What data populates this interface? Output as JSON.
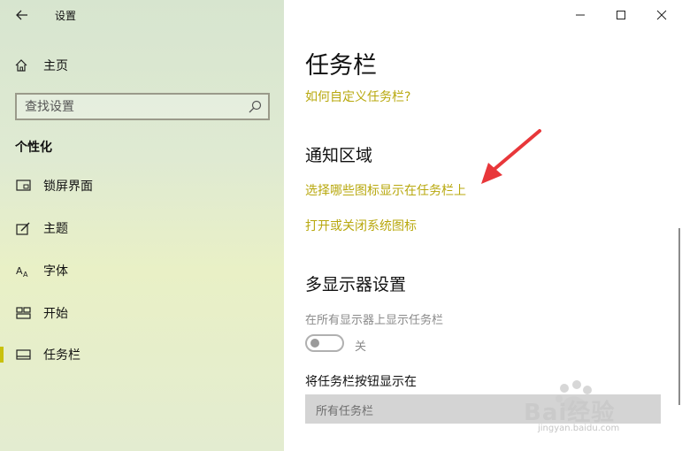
{
  "window": {
    "title": "设置"
  },
  "sidebar": {
    "home_label": "主页",
    "search_placeholder": "查找设置",
    "section_title": "个性化",
    "items": [
      {
        "label": "锁屏界面",
        "icon": "lock-screen-icon"
      },
      {
        "label": "主题",
        "icon": "theme-icon"
      },
      {
        "label": "字体",
        "icon": "font-icon"
      },
      {
        "label": "开始",
        "icon": "start-icon"
      },
      {
        "label": "任务栏",
        "icon": "taskbar-icon",
        "active": true
      }
    ]
  },
  "main": {
    "title": "任务栏",
    "help_link": "如何自定义任务栏?",
    "notification_area": {
      "heading": "通知区域",
      "link1": "选择哪些图标显示在任务栏上",
      "link2": "打开或关闭系统图标"
    },
    "multi_display": {
      "heading": "多显示器设置",
      "show_all_label": "在所有显示器上显示任务栏",
      "toggle_state": "关",
      "buttons_label": "将任务栏按钮显示在",
      "dropdown_value": "所有任务栏"
    }
  },
  "watermark": {
    "brand": "Bai经验",
    "url": "jingyan.baidu.com"
  },
  "colors": {
    "accent": "#b8a80e",
    "active_bar": "#c9c10d",
    "annotation_arrow": "#e8373a"
  }
}
